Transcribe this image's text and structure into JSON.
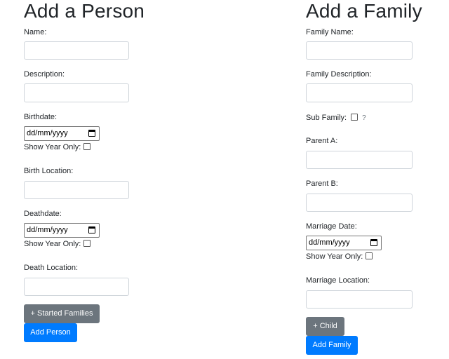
{
  "person": {
    "title": "Add a Person",
    "name_label": "Name:",
    "description_label": "Description:",
    "birthdate_label": "Birthdate:",
    "birthdate_placeholder": "dd/mm/yyyy",
    "birth_year_only_label": "Show Year Only:",
    "birth_location_label": "Birth Location:",
    "deathdate_label": "Deathdate:",
    "deathdate_placeholder": "dd/mm/yyyy",
    "death_year_only_label": "Show Year Only:",
    "death_location_label": "Death Location:",
    "started_families_button": "+ Started Families",
    "add_person_button": "Add Person"
  },
  "family": {
    "title": "Add a Family",
    "family_name_label": "Family Name:",
    "family_description_label": "Family Description:",
    "sub_family_label": "Sub Family:",
    "sub_family_help": "?",
    "parent_a_label": "Parent A:",
    "parent_b_label": "Parent B:",
    "marriage_date_label": "Marriage Date:",
    "marriage_date_placeholder": "dd/mm/yyyy",
    "marriage_year_only_label": "Show Year Only:",
    "marriage_location_label": "Marriage Location:",
    "add_child_button": "+ Child",
    "add_family_button": "Add Family"
  },
  "colors": {
    "primary": "#007bff",
    "secondary": "#6c757d"
  }
}
